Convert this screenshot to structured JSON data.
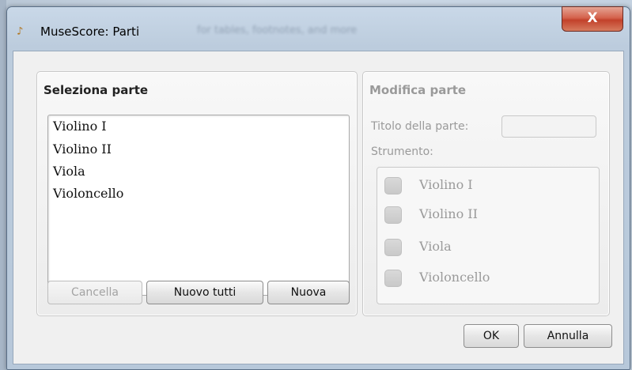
{
  "window": {
    "title": "MuseScore: Parti",
    "app_icon_glyph": "♪",
    "background_hint": "for tables, footnotes, and more",
    "close_glyph": "X"
  },
  "select_part": {
    "title": "Seleziona parte",
    "parts": [
      "Violino I",
      "Violino II",
      "Viola",
      "Violoncello"
    ],
    "buttons": {
      "delete": "Cancella",
      "new_all": "Nuovo tutti",
      "new": "Nuova"
    }
  },
  "edit_part": {
    "title": "Modifica parte",
    "part_title_label": "Titolo della parte:",
    "part_title_value": "",
    "instrument_label": "Strumento:",
    "instruments": [
      "Violino I",
      "Violino II",
      "Viola",
      "Violoncello"
    ]
  },
  "footer": {
    "ok": "OK",
    "cancel": "Annulla"
  },
  "colors": {
    "close_button": "#c9452c",
    "title_bar": "#c9d8e8",
    "dialog_bg": "#f0f0f0",
    "disabled_text": "#9a9a9a"
  }
}
